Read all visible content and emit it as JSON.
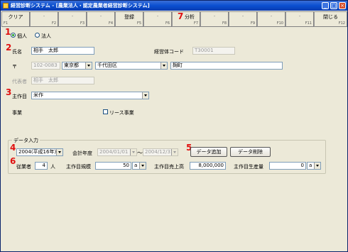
{
  "window": {
    "title": "経営診断システム - [農業法人・認定農業者経営診断システム]",
    "minimize_symbol": "_",
    "maximize_symbol": "□",
    "close_symbol": "×"
  },
  "fkeys": [
    {
      "label": "クリア",
      "key": "F1",
      "enabled": true
    },
    {
      "label": "-",
      "key": "F2",
      "enabled": false
    },
    {
      "label": "-",
      "key": "F3",
      "enabled": false
    },
    {
      "label": "-",
      "key": "F4",
      "enabled": false
    },
    {
      "label": "登録",
      "key": "F5",
      "enabled": true
    },
    {
      "label": "-",
      "key": "F6",
      "enabled": false
    },
    {
      "label": "分析",
      "key": "F7",
      "enabled": true
    },
    {
      "label": "-",
      "key": "F8",
      "enabled": false
    },
    {
      "label": "-",
      "key": "F9",
      "enabled": false
    },
    {
      "label": "-",
      "key": "F10",
      "enabled": false
    },
    {
      "label": "-",
      "key": "F11",
      "enabled": false
    },
    {
      "label": "閉じる",
      "key": "F12",
      "enabled": true
    }
  ],
  "markers": [
    "1",
    "2",
    "3",
    "4",
    "5",
    "6",
    "7"
  ],
  "entity_type": {
    "options": [
      "個人",
      "法人"
    ],
    "selected": "個人"
  },
  "profile": {
    "name_label": "氏名",
    "name_value": "相手　太郎",
    "code_label": "経営体コード",
    "code_value": "T30001",
    "postal_label": "〒",
    "postal_value": "102-0083",
    "prefecture": "東京都",
    "city": "千代田区",
    "address": "麹町",
    "rep_label": "代表者",
    "rep_value": "相手　太郎",
    "crop_label": "主作目",
    "crop_value": "米作",
    "business_label": "事業",
    "lease_label": "リース事業"
  },
  "data_entry": {
    "group_title": "データ入力",
    "year_value": "2004(平成16年)",
    "fiscal_label": "会計年度",
    "fiscal_from": "2004/01/01",
    "tilde": "～",
    "fiscal_to": "2004/12/31",
    "add_button": "データ追加",
    "delete_button": "データ削除",
    "workers_label": "従業者",
    "workers_value": "4",
    "workers_unit": "人",
    "scale_label": "主作目規模",
    "scale_value": "50",
    "scale_unit": "a",
    "sales_label": "主作目売上高",
    "sales_value": "8,000,000",
    "production_label": "主作目生産量",
    "production_value": "0",
    "production_unit": "a"
  }
}
